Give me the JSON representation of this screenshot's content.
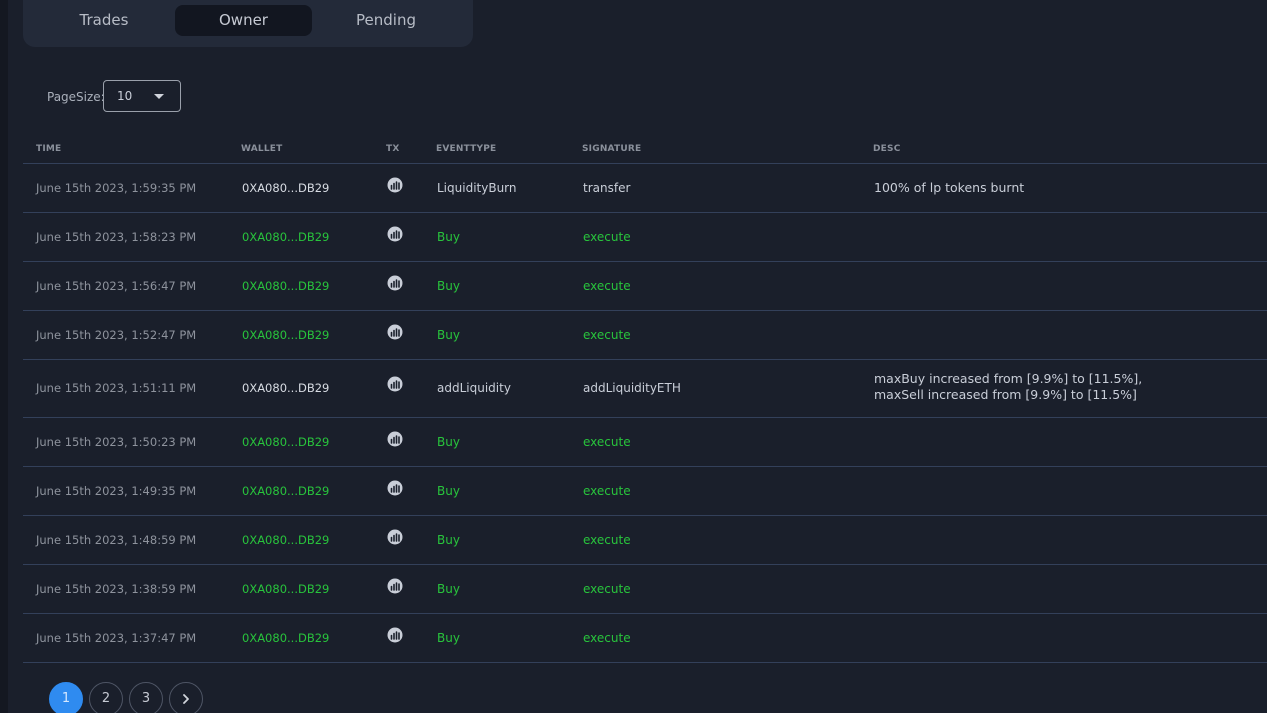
{
  "tabs": [
    {
      "label": "Trades",
      "active": false
    },
    {
      "label": "Owner",
      "active": true
    },
    {
      "label": "Pending",
      "active": false
    }
  ],
  "pagesize": {
    "label": "PageSize:",
    "value": "10"
  },
  "table": {
    "headers": {
      "time": "TIME",
      "wallet": "WALLET",
      "tx": "TX",
      "eventtype": "EVENTTYPE",
      "signature": "SIGNATURE",
      "desc": "DESC"
    },
    "rows": [
      {
        "time": "June 15th 2023, 1:59:35 PM",
        "wallet": "0XA080...DB29",
        "eventtype": "LiquidityBurn",
        "signature": "transfer",
        "desc_lines": [
          "100% of lp tokens burnt"
        ],
        "highlight": false
      },
      {
        "time": "June 15th 2023, 1:58:23 PM",
        "wallet": "0XA080...DB29",
        "eventtype": "Buy",
        "signature": "execute",
        "desc_lines": [],
        "highlight": true
      },
      {
        "time": "June 15th 2023, 1:56:47 PM",
        "wallet": "0XA080...DB29",
        "eventtype": "Buy",
        "signature": "execute",
        "desc_lines": [],
        "highlight": true
      },
      {
        "time": "June 15th 2023, 1:52:47 PM",
        "wallet": "0XA080...DB29",
        "eventtype": "Buy",
        "signature": "execute",
        "desc_lines": [],
        "highlight": true
      },
      {
        "time": "June 15th 2023, 1:51:11 PM",
        "wallet": "0XA080...DB29",
        "eventtype": "addLiquidity",
        "signature": "addLiquidityETH",
        "desc_lines": [
          "maxBuy increased from [9.9%] to [11.5%],",
          "maxSell increased from [9.9%] to [11.5%]"
        ],
        "highlight": false
      },
      {
        "time": "June 15th 2023, 1:50:23 PM",
        "wallet": "0XA080...DB29",
        "eventtype": "Buy",
        "signature": "execute",
        "desc_lines": [],
        "highlight": true
      },
      {
        "time": "June 15th 2023, 1:49:35 PM",
        "wallet": "0XA080...DB29",
        "eventtype": "Buy",
        "signature": "execute",
        "desc_lines": [],
        "highlight": true
      },
      {
        "time": "June 15th 2023, 1:48:59 PM",
        "wallet": "0XA080...DB29",
        "eventtype": "Buy",
        "signature": "execute",
        "desc_lines": [],
        "highlight": true
      },
      {
        "time": "June 15th 2023, 1:38:59 PM",
        "wallet": "0XA080...DB29",
        "eventtype": "Buy",
        "signature": "execute",
        "desc_lines": [],
        "highlight": true
      },
      {
        "time": "June 15th 2023, 1:37:47 PM",
        "wallet": "0XA080...DB29",
        "eventtype": "Buy",
        "signature": "execute",
        "desc_lines": [],
        "highlight": true
      }
    ]
  },
  "pagination": {
    "pages": [
      "1",
      "2",
      "3"
    ],
    "current": "1",
    "next_icon": "chevron-right-icon"
  },
  "colors": {
    "background": "#1a1f2b",
    "tab_bar": "#232a39",
    "tab_active": "#121620",
    "buy_green": "#28c43c",
    "page_active": "#2f8bf0",
    "divider": "#33405a"
  },
  "tx_icon": "etherscan-icon"
}
